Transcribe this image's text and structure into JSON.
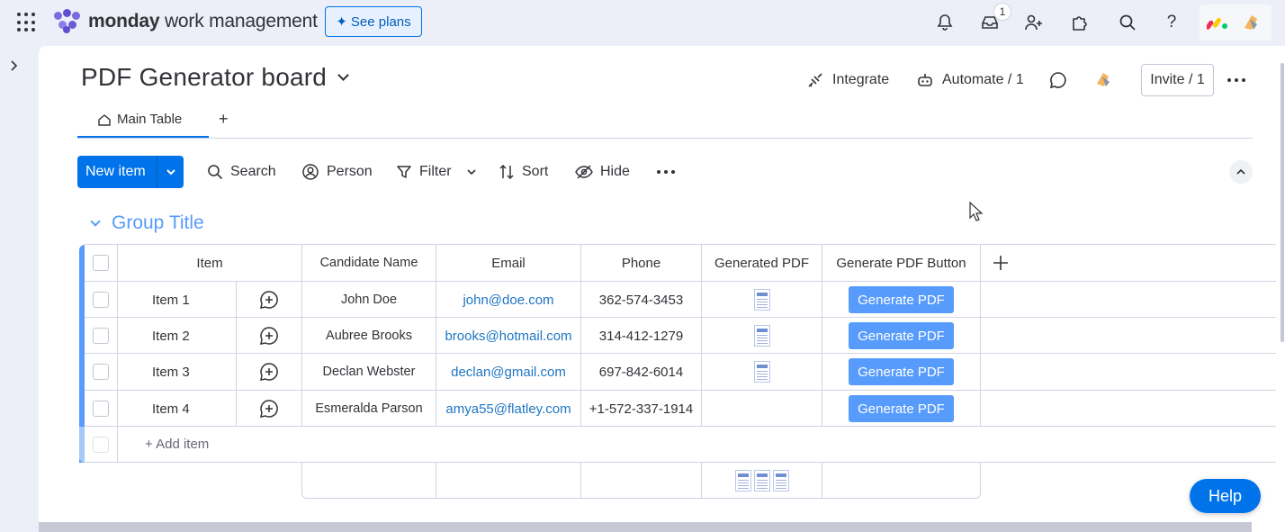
{
  "topbar": {
    "brand_bold": "monday",
    "brand_rest": "work management",
    "see_plans": "See plans",
    "inbox_count": "1",
    "colors": {
      "accent": "#0073ea",
      "brand_purple": "#6c5bd6"
    }
  },
  "board": {
    "title": "PDF Generator board",
    "integrate": "Integrate",
    "automate": "Automate / 1",
    "invite": "Invite / 1"
  },
  "tabs": [
    {
      "label": "Main Table"
    }
  ],
  "toolbar": {
    "new_item": "New item",
    "search": "Search",
    "person": "Person",
    "filter": "Filter",
    "sort": "Sort",
    "hide": "Hide"
  },
  "group": {
    "title": "Group Title",
    "color": "#579bfc",
    "columns": [
      "Item",
      "Candidate Name",
      "Email",
      "Phone",
      "Generated PDF",
      "Generate PDF Button"
    ],
    "rows": [
      {
        "item": "Item 1",
        "candidate": "John Doe",
        "email": "john@doe.com",
        "phone": "362-574-3453",
        "has_pdf": true,
        "button": "Generate PDF"
      },
      {
        "item": "Item 2",
        "candidate": "Aubree Brooks",
        "email": "brooks@hotmail.com",
        "phone": "314-412-1279",
        "has_pdf": true,
        "button": "Generate PDF"
      },
      {
        "item": "Item 3",
        "candidate": "Declan Webster",
        "email": "declan@gmail.com",
        "phone": "697-842-6014",
        "has_pdf": true,
        "button": "Generate PDF"
      },
      {
        "item": "Item 4",
        "candidate": "Esmeralda Parson",
        "email": "amya55@flatley.com",
        "phone": "+1-572-337-1914",
        "has_pdf": false,
        "button": "Generate PDF"
      }
    ],
    "add_item": "+ Add item"
  },
  "help": "Help"
}
